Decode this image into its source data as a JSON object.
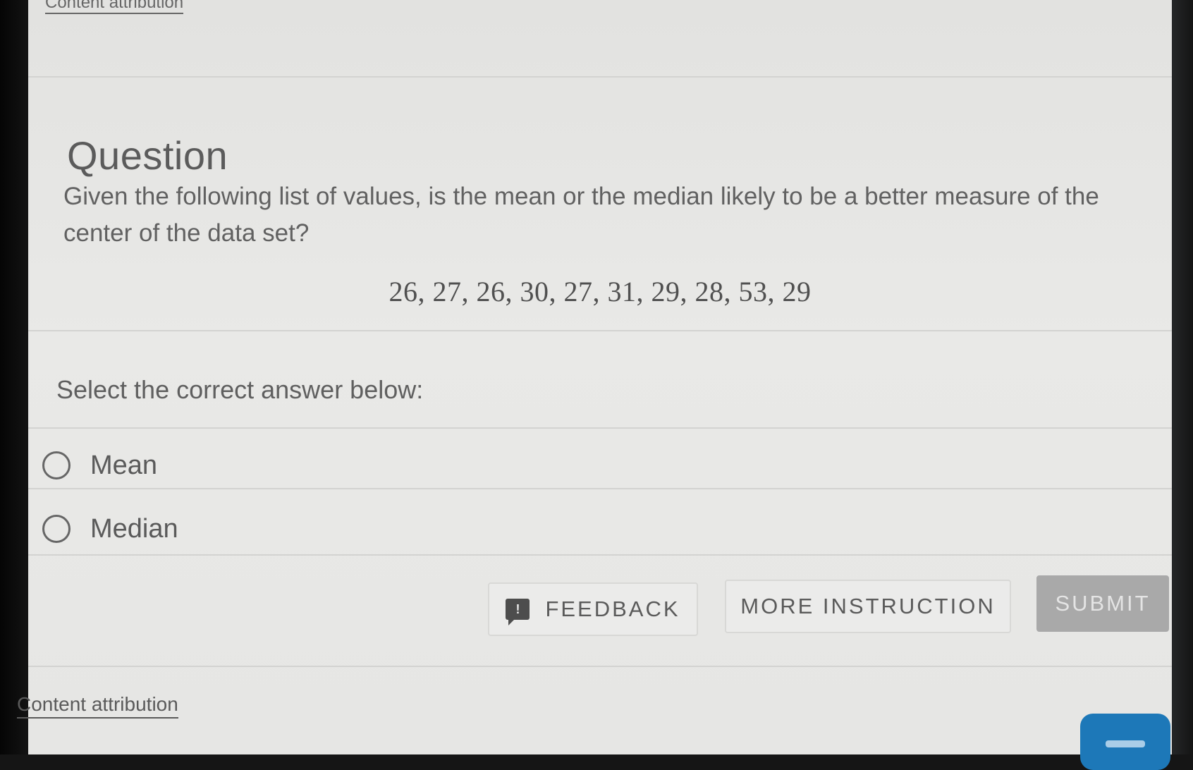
{
  "header": {
    "attribution_label": "Content attribution"
  },
  "question": {
    "title": "Question",
    "text": "Given the following list of values, is the mean or the median likely to be a better measure of the center of the data set?",
    "values": "26, 27, 26, 30, 27, 31, 29, 28, 53, 29"
  },
  "answer": {
    "prompt": "Select the correct answer below:",
    "options": [
      {
        "label": "Mean",
        "selected": false
      },
      {
        "label": "Median",
        "selected": false
      }
    ]
  },
  "actions": {
    "feedback_label": "FEEDBACK",
    "more_instruction_label": "MORE INSTRUCTION",
    "submit_label": "SUBMIT",
    "feedback_icon": "speech-bubble-exclamation-icon",
    "chat_icon": "chat-icon"
  },
  "footer": {
    "attribution_label": "Content attribution"
  },
  "colors": {
    "page_background": "#e6e6e4",
    "text": "#5a5a5a",
    "submit_disabled": "#a9a9a9",
    "chat_button": "#1d78b8"
  }
}
